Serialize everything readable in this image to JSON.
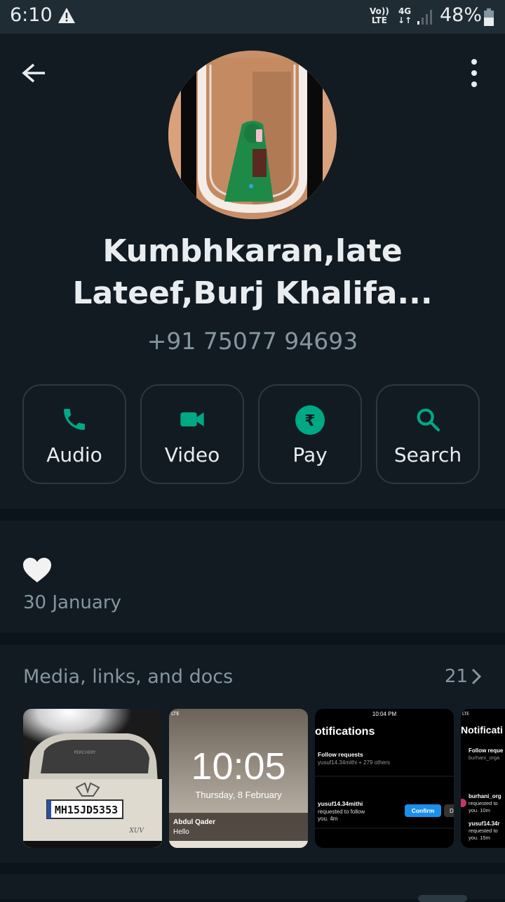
{
  "status_bar": {
    "time": "6:10",
    "volte_line1": "Vo))",
    "volte_line2": "LTE",
    "net_line1": "4G",
    "net_line2": "↓↑",
    "battery": "48%"
  },
  "header": {
    "back_icon": "arrow-left-icon",
    "menu_icon": "more-vert-icon"
  },
  "contact": {
    "name_line1": "Kumbhkaran,late",
    "name_line2": "Lateef,Burj Khalifa...",
    "phone": "+91 75077 94693"
  },
  "actions": [
    {
      "label": "Audio",
      "icon": "phone-icon"
    },
    {
      "label": "Video",
      "icon": "videocam-icon"
    },
    {
      "label": "Pay",
      "icon": "rupee-icon"
    },
    {
      "label": "Search",
      "icon": "search-icon"
    }
  ],
  "about": {
    "emoji": "🤍",
    "date": "30 January"
  },
  "media": {
    "title": "Media, links, and docs",
    "count": "21",
    "thumbs": [
      {
        "kind": "car-photo",
        "plate": "MH15JD5353",
        "badge": "PERCHERY",
        "model": "XUV"
      },
      {
        "kind": "lockscreen",
        "time": "10:05",
        "date": "Thursday, 8 February",
        "sender": "Abdul Qader",
        "message": "Hello",
        "corner": "LTE"
      },
      {
        "kind": "notifications",
        "clock": "10:04 PM",
        "title": "otifications",
        "follow_title": "Follow requests",
        "follow_sub": "yusuf14.34mithi + 279 others",
        "user": "yusuf14.34mithi",
        "req": "requested to follow",
        "req2": "you. 4m",
        "confirm": "Confirm",
        "d": "D"
      },
      {
        "kind": "notifications2",
        "corner": "LTE",
        "title": "Notificati",
        "follow_title": "Follow reque",
        "follow_sub": "burhani_orga",
        "u1": "burhani_org",
        "u1a": "requested to",
        "u1b": "you. 10m",
        "u2": "yusuf14.34r",
        "u2a": "requested to",
        "u2b": "you. 15m"
      }
    ]
  },
  "colors": {
    "accent": "#00a884",
    "background": "#0b141a",
    "surface": "#121b22",
    "secondary_text": "#8696a0"
  }
}
